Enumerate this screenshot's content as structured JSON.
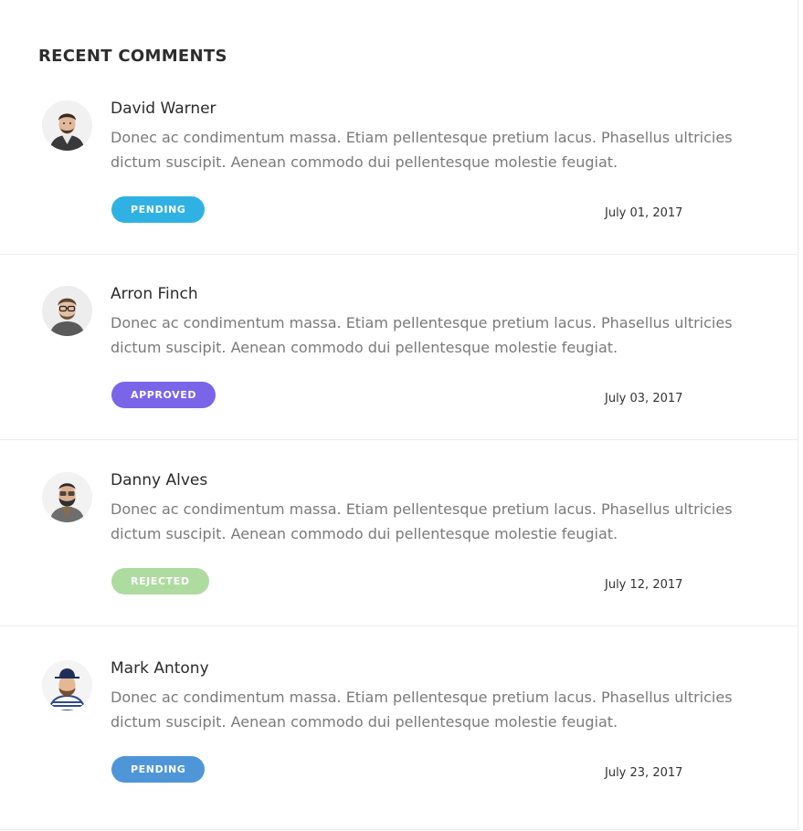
{
  "widget": {
    "title": "RECENT COMMENTS"
  },
  "comments": [
    {
      "author": "David Warner",
      "text": "Donec ac condimentum massa. Etiam pellentesque pretium lacus. Phasellus ultricies dictum suscipit. Aenean commodo dui pellentesque molestie feugiat.",
      "status": "PENDING",
      "status_color": "#2fb2e3",
      "date": "July  01, 2017"
    },
    {
      "author": "Arron Finch",
      "text": "Donec ac condimentum massa. Etiam pellentesque pretium lacus. Phasellus ultricies dictum suscipit. Aenean commodo dui pellentesque molestie feugiat.",
      "status": "APPROVED",
      "status_color": "#7a64e8",
      "date": "July  03, 2017"
    },
    {
      "author": "Danny Alves",
      "text": "Donec ac condimentum massa. Etiam pellentesque pretium lacus. Phasellus ultricies dictum suscipit. Aenean commodo dui pellentesque molestie feugiat.",
      "status": "REJECTED",
      "status_color": "#aedba0",
      "date": "July 12, 2017"
    },
    {
      "author": "Mark Antony",
      "text": "Donec ac condimentum massa. Etiam pellentesque pretium lacus. Phasellus ultricies dictum suscipit. Aenean commodo dui pellentesque molestie feugiat.",
      "status": "PENDING",
      "status_color": "#4e96d8",
      "date": "July 23, 2017"
    }
  ]
}
